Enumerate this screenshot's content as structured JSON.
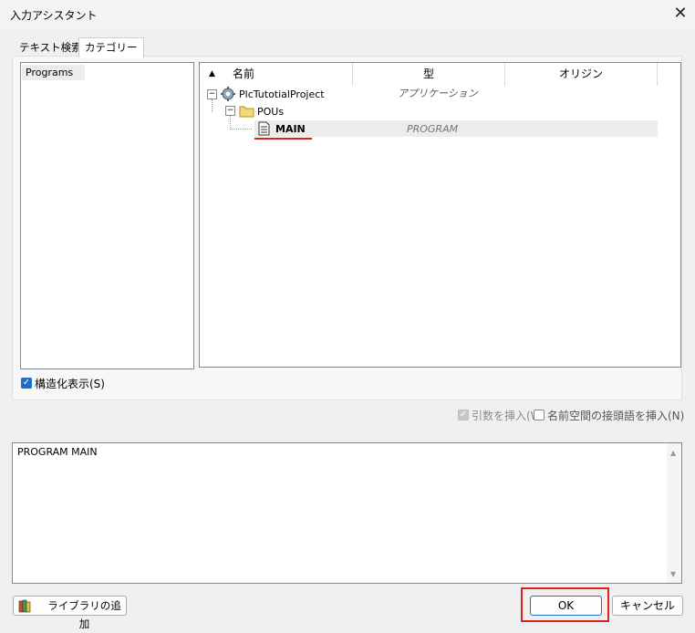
{
  "window": {
    "title": "入力アシスタント"
  },
  "tabs": [
    {
      "label": "テキスト検索"
    },
    {
      "label": "カテゴリー"
    }
  ],
  "categories": [
    "Programs"
  ],
  "tree": {
    "columns": {
      "name": "名前",
      "type": "型",
      "origin": "オリジン"
    },
    "nodes": [
      {
        "name": "PlcTutotialProject",
        "type": "アプリケーション"
      },
      {
        "name": "POUs",
        "type": ""
      },
      {
        "name": "MAIN",
        "type": "PROGRAM"
      }
    ]
  },
  "options": {
    "structured_view": {
      "label": "構造化表示(S)",
      "checked": true
    },
    "insert_args": {
      "label": "引数を挿入(W",
      "checked": true,
      "enabled": false
    },
    "insert_namespace": {
      "label": "名前空間の接頭語を挿入(N)",
      "checked": false
    }
  },
  "preview_text": "PROGRAM MAIN",
  "buttons": {
    "add_library": "ライブラリの追加",
    "ok": "OK",
    "cancel": "キャンセル"
  },
  "colors": {
    "highlight": "#e02020",
    "checkbox": "#1a6fc9"
  }
}
